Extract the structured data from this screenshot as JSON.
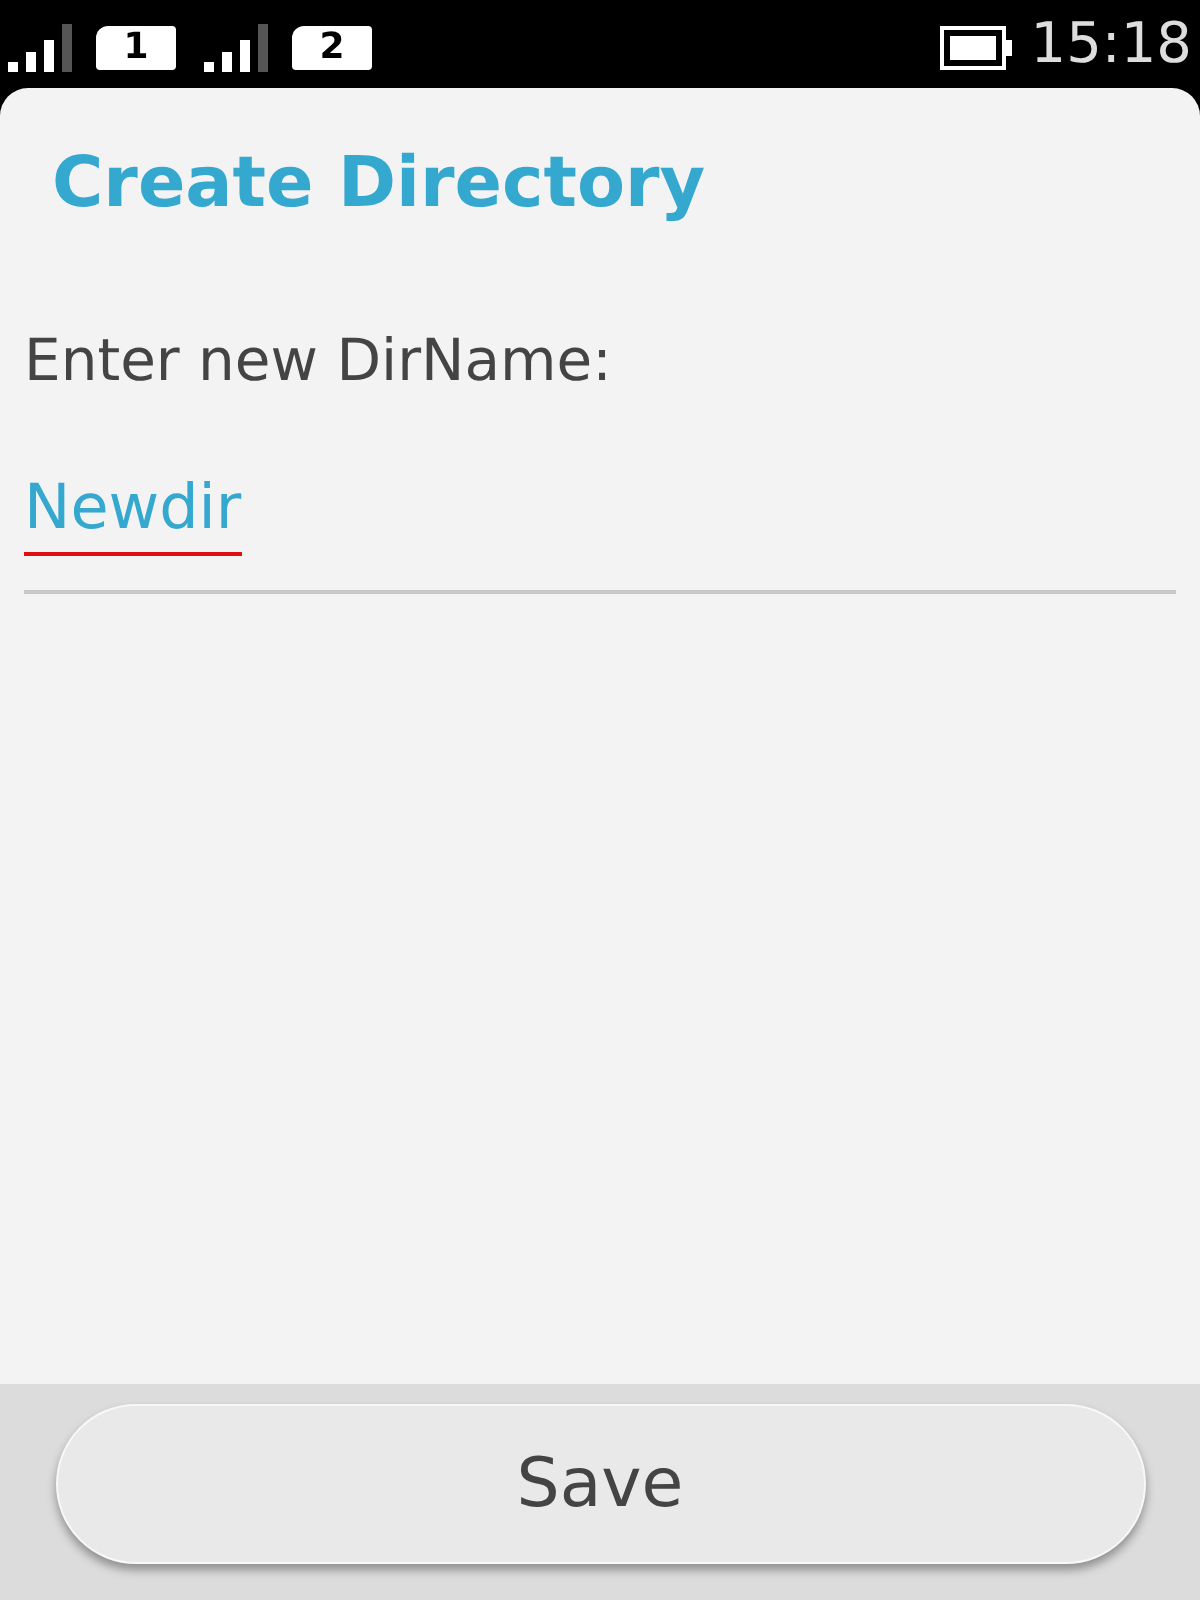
{
  "status_bar": {
    "sims": [
      {
        "label": "1"
      },
      {
        "label": "2"
      }
    ],
    "time": "15:18"
  },
  "dialog": {
    "title": "Create Directory",
    "field": {
      "label": "Enter new DirName:",
      "value": "Newdir",
      "spelling_error": true
    }
  },
  "buttons": [
    {
      "label": "Save"
    }
  ]
}
